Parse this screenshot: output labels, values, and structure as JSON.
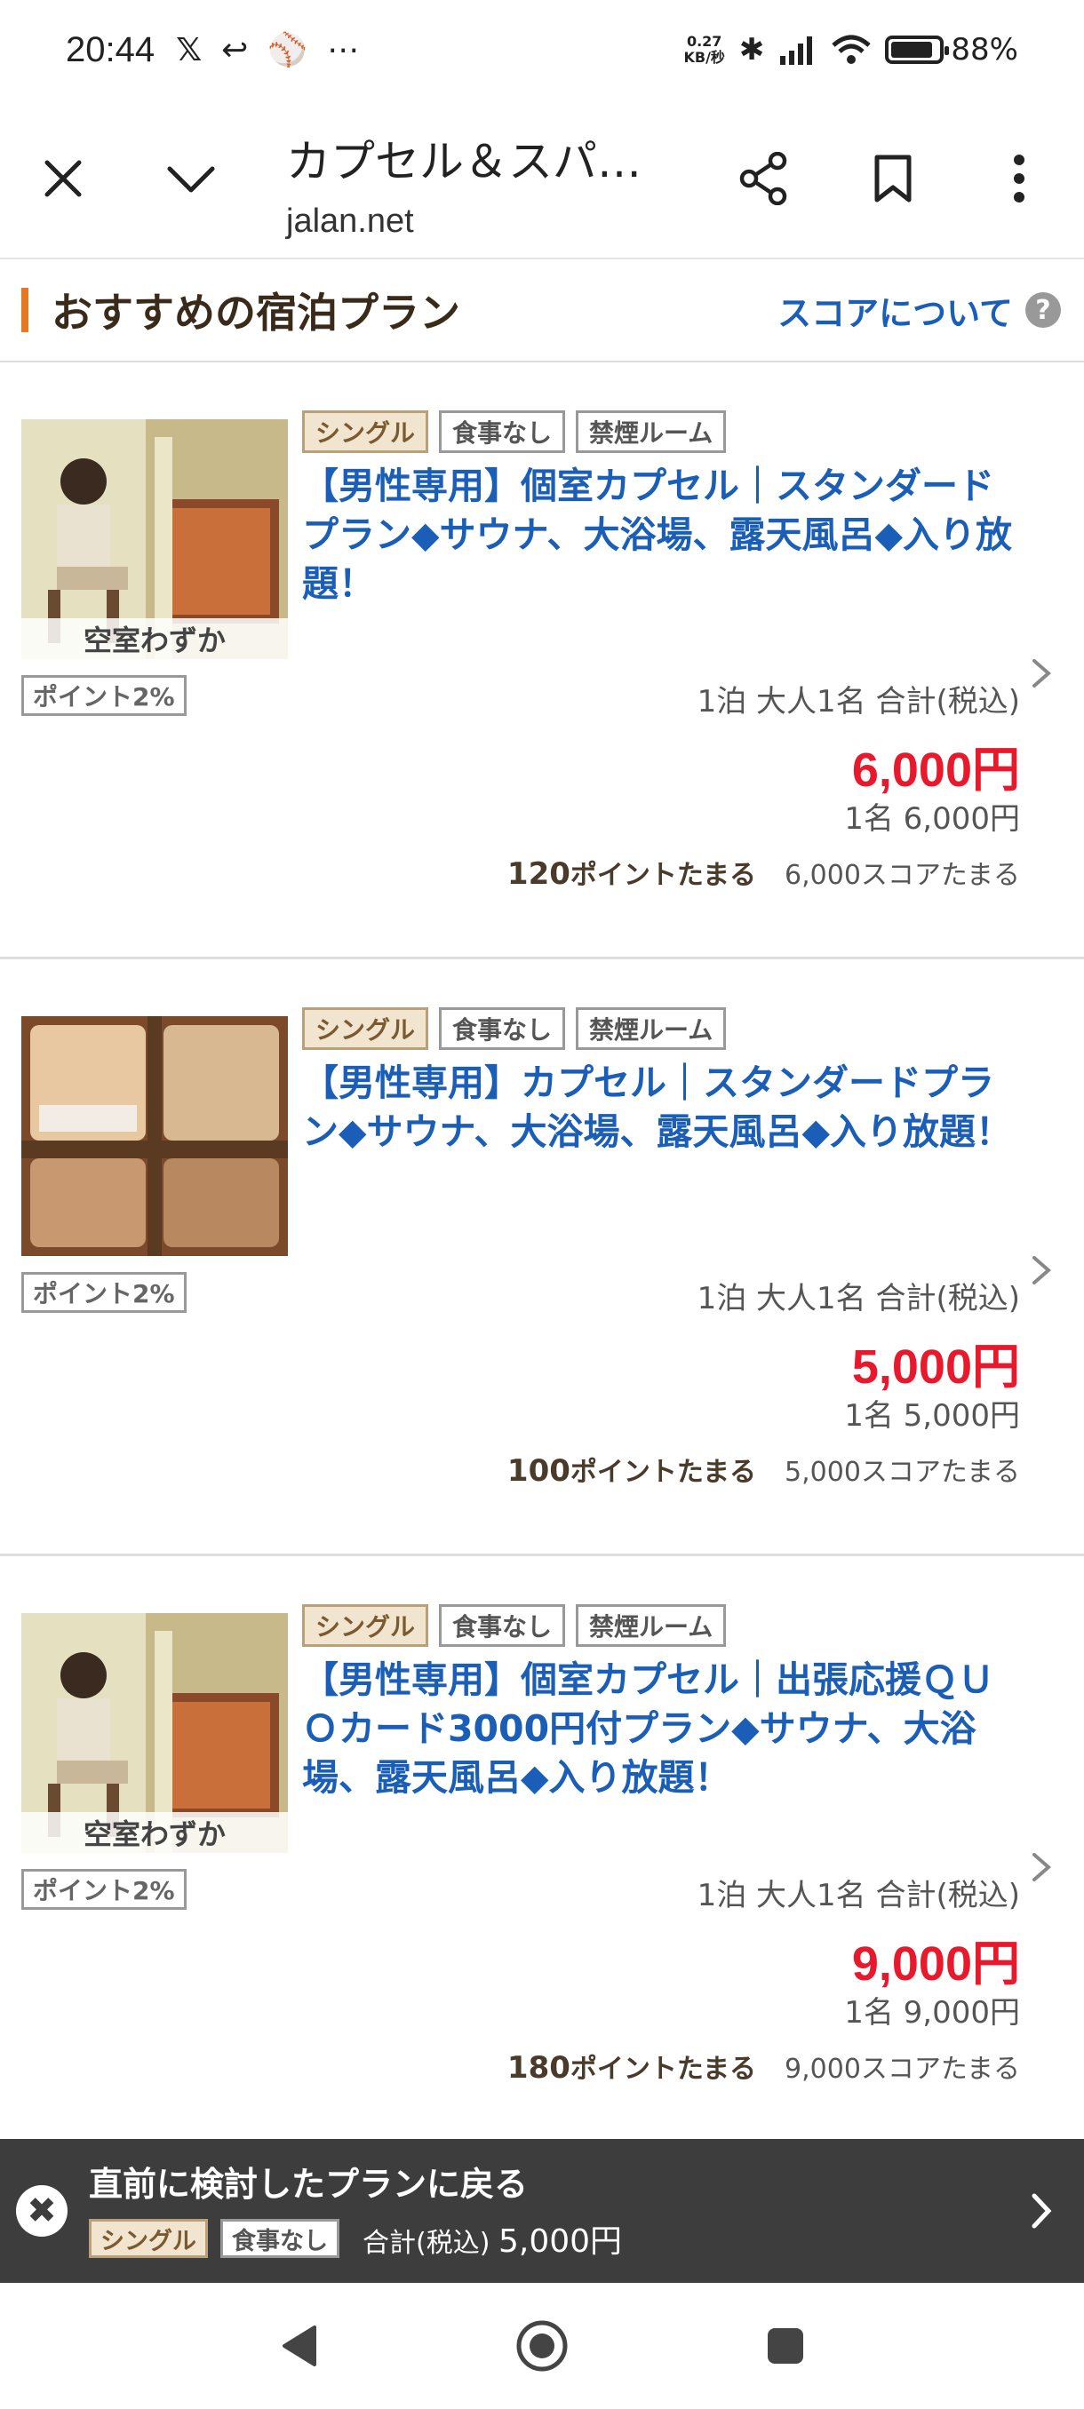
{
  "status_bar": {
    "time": "20:44",
    "speed_value": "0.27",
    "speed_unit": "KB/秒",
    "battery": "88%",
    "battery_level": 0.88
  },
  "browser": {
    "title": "カプセル＆スパ…",
    "domain": "jalan.net"
  },
  "section": {
    "title": "おすすめの宿泊プラン",
    "score_link": "スコアについて",
    "help": "?"
  },
  "plans": [
    {
      "tags": [
        "シングル",
        "食事なし",
        "禁煙ルーム"
      ],
      "title": "【男性専用】個室カプセル｜スタンダードプラン◆サウナ、大浴場、露天風呂◆入り放題！",
      "vacancy": "空室わずか",
      "points_badge": "ポイント2%",
      "price_condition": "1泊 大人1名 合計(税込)",
      "price": "6,000円",
      "per_person": "1名 6,000円",
      "points_earn_num": "120",
      "points_earn_text": "ポイントたまる",
      "score_earn": "6,000スコアたまる"
    },
    {
      "tags": [
        "シングル",
        "食事なし",
        "禁煙ルーム"
      ],
      "title": "【男性専用】カプセル｜スタンダードプラン◆サウナ、大浴場、露天風呂◆入り放題！",
      "vacancy": "",
      "points_badge": "ポイント2%",
      "price_condition": "1泊 大人1名 合計(税込)",
      "price": "5,000円",
      "per_person": "1名 5,000円",
      "points_earn_num": "100",
      "points_earn_text": "ポイントたまる",
      "score_earn": "5,000スコアたまる"
    },
    {
      "tags": [
        "シングル",
        "食事なし",
        "禁煙ルーム"
      ],
      "title": "【男性専用】個室カプセル｜出張応援ＱＵＯカード3000円付プラン◆サウナ、大浴場、露天風呂◆入り放題！",
      "vacancy": "空室わずか",
      "points_badge": "ポイント2%",
      "price_condition": "1泊 大人1名 合計(税込)",
      "price": "9,000円",
      "per_person": "1名 9,000円",
      "points_earn_num": "180",
      "points_earn_text": "ポイントたまる",
      "score_earn": "9,000スコアたまる"
    }
  ],
  "recent_plan": {
    "title": "直前に検討したプランに戻る",
    "tags": [
      "シングル",
      "食事なし"
    ],
    "price_label": "合計(税込)",
    "price": "5,000円"
  },
  "colors": {
    "link_blue": "#1a5eb8",
    "price_red": "#e8192c",
    "accent_orange": "#e87722",
    "overlay_gray": "#3d3d3d"
  }
}
